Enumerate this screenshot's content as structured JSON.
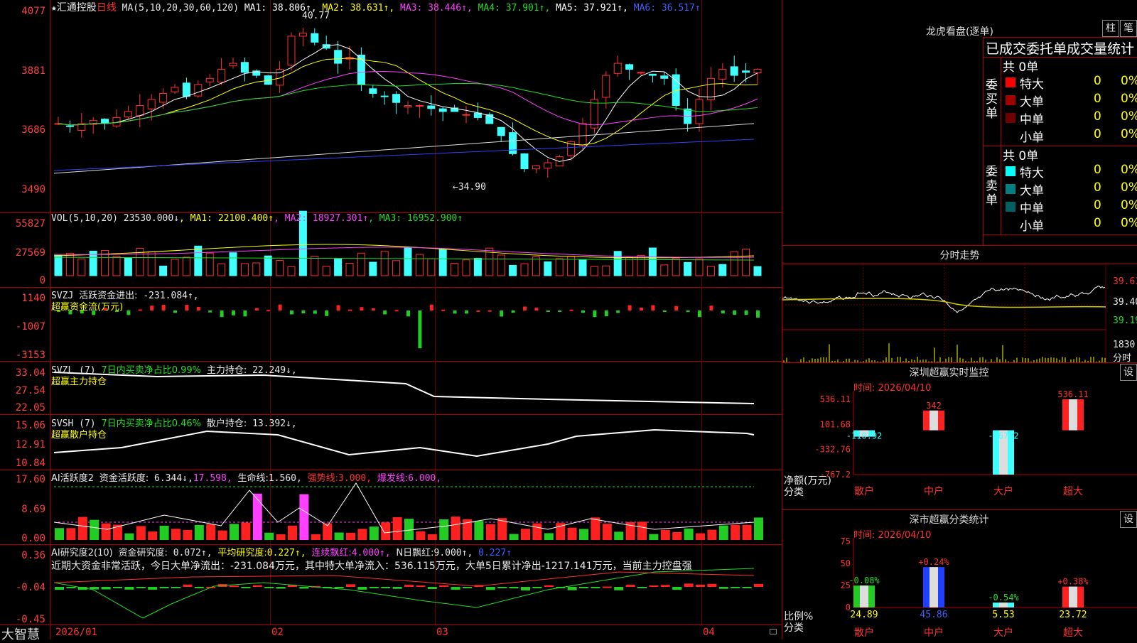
{
  "main_chart": {
    "star": "★",
    "stock_name": "汇通控股",
    "period": "日线",
    "ma_spec": "MA(5,10,20,30,60,120)",
    "ma_values": [
      {
        "name": "MA1",
        "value": "38.806↑",
        "color": "#ffffff"
      },
      {
        "name": "MA2",
        "value": "38.631↑",
        "color": "#ffff00"
      },
      {
        "name": "MA3",
        "value": "38.446↑",
        "color": "#ff40ff"
      },
      {
        "name": "MA4",
        "value": "37.901↑",
        "color": "#22dd22"
      },
      {
        "name": "MA5",
        "value": "37.921↑",
        "color": "#ffffff"
      },
      {
        "name": "MA6",
        "value": "36.517↑",
        "color": "#4060ff"
      }
    ],
    "y_ticks": [
      "4077",
      "3881",
      "3686",
      "3490"
    ],
    "high_mark": "40.77",
    "low_mark": "←34.90"
  },
  "vol_panel": {
    "label": "VOL(5,10,20)",
    "value": "23530.000↓",
    "ma": [
      {
        "name": "MA1",
        "value": "22100.400↑",
        "color": "#ffff00"
      },
      {
        "name": "MA2",
        "value": "18927.301↑",
        "color": "#ff40ff"
      },
      {
        "name": "MA3",
        "value": "16952.900↑",
        "color": "#22dd22"
      }
    ],
    "y_ticks": [
      "55827",
      "27569",
      "0"
    ]
  },
  "svzj_panel": {
    "label": "SVZJ",
    "title": "活跃资金进出:",
    "value": "-231.084↑,",
    "subtitle": "超赢资金流(万元)",
    "y_ticks": [
      "1140",
      "-1007",
      "-3153"
    ]
  },
  "svzl_panel": {
    "label": "SVZL (7)",
    "ratio": "7日内买卖净占比0.99%",
    "hold_label": "主力持仓:",
    "hold_value": "22.249↓,",
    "subtitle": "超赢主力持仓",
    "y_ticks": [
      "33.04",
      "27.54",
      "22.05"
    ]
  },
  "svsh_panel": {
    "label": "SVSH (7)",
    "ratio": "7日内买卖净占比0.46%",
    "hold_label": "散户持仓:",
    "hold_value": "13.392↓,",
    "subtitle": "超赢散户持仓",
    "y_ticks": [
      "15.06",
      "12.91",
      "10.84"
    ]
  },
  "ai_active_panel": {
    "label": "AI活跃度2",
    "t1": "资金活跃度:",
    "v1": "6.344↓,",
    "v2": "17.598,",
    "t3": "生命线:",
    "v3": "1.560,",
    "t4": "强势线:",
    "v4": "3.000,",
    "t5": "爆发线:",
    "v5": "6.000,",
    "y_ticks": [
      "17.60",
      "8.69",
      "0.00"
    ]
  },
  "ai_research_panel": {
    "label": "AI研究度2(10)",
    "t1": "资金研究度:",
    "v1": "0.072↑,",
    "t2": "平均研究度:",
    "v2": "0.227↑,",
    "t3": "连续飘红:",
    "v3": "4.000↑,",
    "t4": "N日飘红:",
    "v4": "9.000↑,",
    "v5": "0.227↑",
    "summary": "近期大资金非常活跃，今日大单净流出：-231.084万元，其中特大单净流入：536.115万元，大单5日累计净出-1217.141万元，当前主力控盘强",
    "y_ticks": [
      "0.36",
      "-0.04",
      "-0.45"
    ]
  },
  "bottom_axis": {
    "brand": "大智慧",
    "dates": [
      "2026/01",
      "02",
      "03",
      "04"
    ]
  },
  "dragon_tiger": {
    "title": "龙虎看盘(逐单)",
    "btn1": "柱",
    "btn2": "笔",
    "header": "已成交委托单成交量统计",
    "buy": {
      "side": "委买单",
      "total": "共 0单",
      "rows": [
        {
          "name": "特大",
          "count": "0",
          "pct": "0%",
          "color": "#ff0000"
        },
        {
          "name": "大单",
          "count": "0",
          "pct": "0%",
          "color": "#a00000"
        },
        {
          "name": "中单",
          "count": "0",
          "pct": "0%",
          "color": "#700000"
        },
        {
          "name": "小单",
          "count": "0",
          "pct": "0%",
          "color": "#000000"
        }
      ]
    },
    "sell": {
      "side": "委卖单",
      "total": "共 0单",
      "rows": [
        {
          "name": "特大",
          "count": "0",
          "pct": "0%",
          "color": "#00ffff"
        },
        {
          "name": "大单",
          "count": "0",
          "pct": "0%",
          "color": "#008080"
        },
        {
          "name": "中单",
          "count": "0",
          "pct": "0%",
          "color": "#006060"
        },
        {
          "name": "小单",
          "count": "0",
          "pct": "0%",
          "color": "#000000"
        }
      ]
    }
  },
  "intraday": {
    "title": "分时走势",
    "price_ticks": [
      "39.61",
      "39.40",
      "39.19"
    ],
    "vol_tick": "1830",
    "vol_unit": "分时"
  },
  "sz_monitor": {
    "title": "深圳超赢实时监控",
    "btn": "设",
    "time": "时间: 2026/04/10",
    "y_ticks": [
      "536.11",
      "101.68",
      "-332.76",
      "-767.2"
    ],
    "bars": [
      {
        "name": "散户",
        "value": -110.92,
        "label": "-110.92"
      },
      {
        "name": "中户",
        "value": 342,
        "label": "342"
      },
      {
        "name": "大户",
        "value": -767.2,
        "label": "-767.2"
      },
      {
        "name": "超大",
        "value": 536.11,
        "label": "536.11"
      }
    ],
    "ylabel1": "净额(万元)",
    "ylabel2": "分类"
  },
  "sz_class": {
    "title": "深市超赢分类统计",
    "btn": "设",
    "time": "时间: 2026/04/10",
    "y_ticks": [
      "75",
      "50",
      "25",
      "0"
    ],
    "bars": [
      {
        "name": "散户",
        "value": 24.89,
        "label": "24.89",
        "change": "-0.08%"
      },
      {
        "name": "中户",
        "value": 45.86,
        "label": "45.86",
        "change": "+0.24%"
      },
      {
        "name": "大户",
        "value": 5.53,
        "label": "5.53",
        "change": "-0.54%"
      },
      {
        "name": "超大",
        "value": 23.72,
        "label": "23.72",
        "change": "+0.38%"
      }
    ],
    "ylabel1": "比例%",
    "ylabel2": "分类"
  },
  "chart_data": [
    {
      "type": "bar",
      "title": "深圳超赢实时监控",
      "categories": [
        "散户",
        "中户",
        "大户",
        "超大"
      ],
      "values": [
        -110.92,
        342,
        -767.2,
        536.11
      ],
      "ylabel": "净额(万元)",
      "ylim": [
        -767.2,
        536.11
      ]
    },
    {
      "type": "bar",
      "title": "深市超赢分类统计",
      "categories": [
        "散户",
        "中户",
        "大户",
        "超大"
      ],
      "values": [
        24.89,
        45.86,
        5.53,
        23.72
      ],
      "ylabel": "比例%",
      "ylim": [
        0,
        75
      ]
    }
  ]
}
